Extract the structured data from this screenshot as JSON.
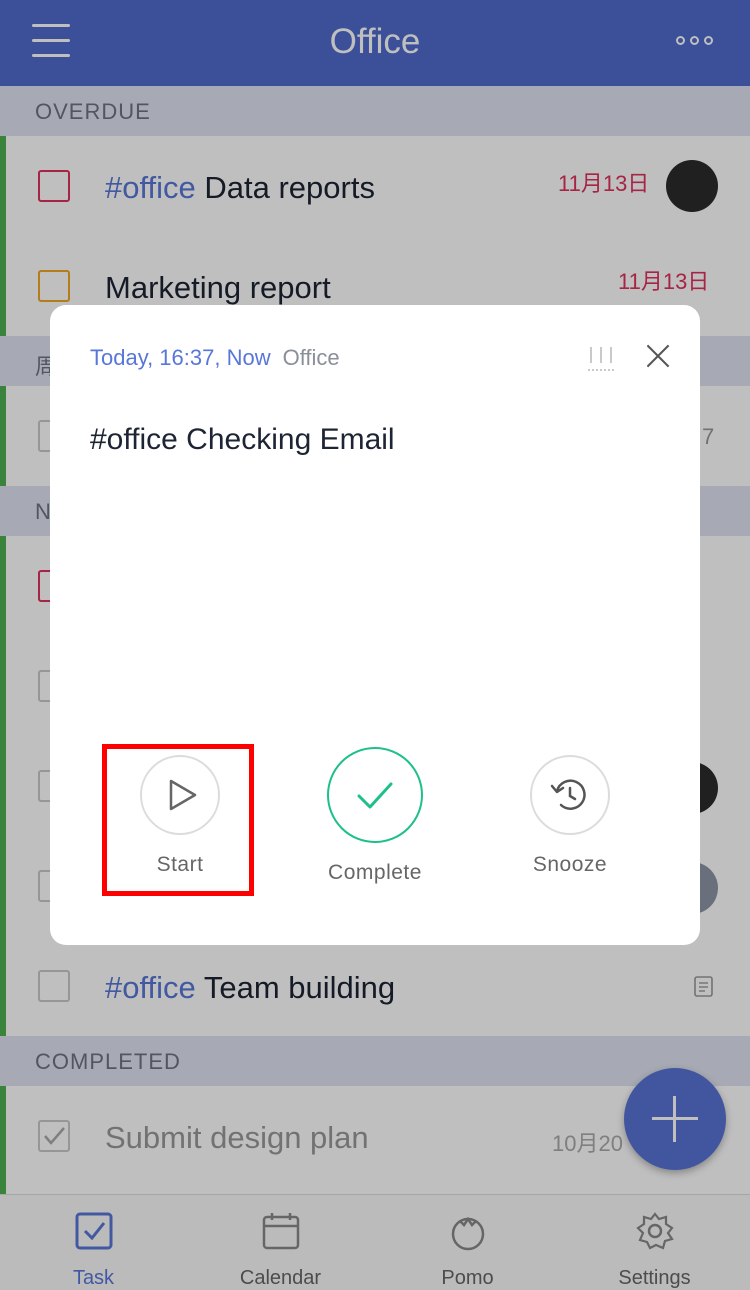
{
  "header": {
    "title": "Office"
  },
  "sections": {
    "overdue": "OVERDUE",
    "week_partial": "周",
    "next_partial": "N",
    "completed": "COMPLETED"
  },
  "tasks": {
    "t1": {
      "tag": "#office",
      "title": " Data reports",
      "date": "11月13日"
    },
    "t2": {
      "title": "Marketing report",
      "date": "11月13日"
    },
    "t3": {
      "date_partial": "7"
    },
    "t4": {
      "tag": "#office",
      "title": " Team building"
    },
    "t5": {
      "title": "Submit  design plan",
      "date": "10月20"
    }
  },
  "modal": {
    "when": "Today, 16:37, Now",
    "list": "Office",
    "task_title": "#office Checking Email",
    "actions": {
      "start": "Start",
      "complete": "Complete",
      "snooze": "Snooze"
    }
  },
  "nav": {
    "task": "Task",
    "calendar": "Calendar",
    "pomo": "Pomo",
    "settings": "Settings"
  },
  "colors": {
    "accent": "#4f6bcb",
    "tag": "#5877d8",
    "overdue_date": "#e0315d",
    "complete": "#1dbf8a",
    "highlight": "#ff0000"
  }
}
